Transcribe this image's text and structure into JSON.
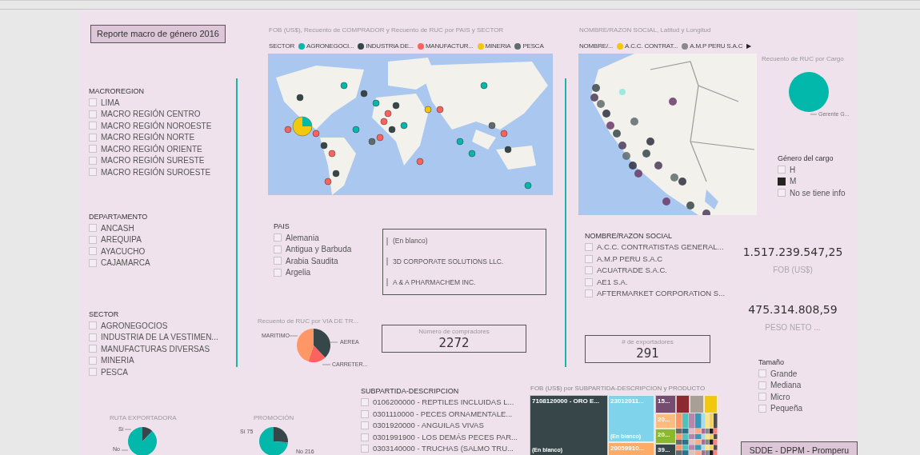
{
  "report_button": {
    "label": "Reporte macro de género 2016"
  },
  "macroregion": {
    "title": "MACROREGION",
    "items": [
      {
        "label": "LIMA",
        "checked": false
      },
      {
        "label": "MACRO REGIÓN CENTRO",
        "checked": false
      },
      {
        "label": "MACRO REGIÓN NOROESTE",
        "checked": false
      },
      {
        "label": "MACRO REGIÓN NORTE",
        "checked": false
      },
      {
        "label": "MACRO REGIÓN ORIENTE",
        "checked": false
      },
      {
        "label": "MACRO REGIÓN SURESTE",
        "checked": false
      },
      {
        "label": "MACRO REGIÓN SUROESTE",
        "checked": false
      }
    ]
  },
  "departamento": {
    "title": "DEPARTAMENTO",
    "items": [
      {
        "label": "ANCASH",
        "checked": false
      },
      {
        "label": "AREQUIPA",
        "checked": false
      },
      {
        "label": "AYACUCHO",
        "checked": false
      },
      {
        "label": "CAJAMARCA",
        "checked": false
      }
    ]
  },
  "sector": {
    "title": "SECTOR",
    "items": [
      {
        "label": "AGRONEGOCIOS",
        "checked": false
      },
      {
        "label": "INDUSTRIA DE LA VESTIMEN...",
        "checked": false
      },
      {
        "label": "MANUFACTURAS DIVERSAS",
        "checked": false
      },
      {
        "label": "MINERIA",
        "checked": false
      },
      {
        "label": "PESCA",
        "checked": false
      }
    ]
  },
  "world_map": {
    "title": "FOB (US$), Recuento de COMPRADOR y Recuento de RUC por PAIS y SECTOR",
    "legend_title": "SECTOR",
    "legend": [
      {
        "label": "AGRONEGOCI...",
        "color": "#01b8aa"
      },
      {
        "label": "INDUSTRIA DE...",
        "color": "#374649"
      },
      {
        "label": "MANUFACTUR...",
        "color": "#fd625e"
      },
      {
        "label": "MINERIA",
        "color": "#f2c80f"
      },
      {
        "label": "PESCA",
        "color": "#5f6b6d"
      }
    ]
  },
  "peru_map": {
    "title": "NOMBRE/RAZON SOCIAL, Latitud y Longitud",
    "legend_title": "NOMBRE/...",
    "legend": [
      {
        "label": "A.C.C. CONTRAT...",
        "color": "#f2c80f"
      },
      {
        "label": "A.M.P PERU S.A.C",
        "color": "#8a8a8a"
      }
    ],
    "more_arrow": "▶"
  },
  "cargo_chart": {
    "title": "Recuento de RUC por Cargo",
    "label": "Gerente G..."
  },
  "genero": {
    "title": "Género del cargo",
    "items": [
      {
        "label": "H",
        "checked": false
      },
      {
        "label": "M",
        "checked": true
      },
      {
        "label": "No se tiene info",
        "checked": false
      }
    ]
  },
  "pais": {
    "title": "PAIS",
    "items": [
      {
        "label": "Alemania",
        "checked": false
      },
      {
        "label": "Antigua y Barbuda",
        "checked": false
      },
      {
        "label": "Arabia Saudita",
        "checked": false
      },
      {
        "label": "Argelia",
        "checked": false
      }
    ]
  },
  "buyers_table": {
    "rows": [
      "(En blanco)",
      "3D CORPORATE SOLUTIONS LLC.",
      "A & A PHARMACHEM INC."
    ]
  },
  "via_chart": {
    "title": "Recuento de RUC por VIA DE TR...",
    "labels": [
      "MARITIMO",
      "AEREA",
      "CARRETER..."
    ]
  },
  "compradores_card": {
    "label": "Número de compradores",
    "value": "2272"
  },
  "nombre": {
    "title": "NOMBRE/RAZON SOCIAL",
    "items": [
      {
        "label": "A.C.C. CONTRATISTAS GENERAL...",
        "checked": false
      },
      {
        "label": "A.M.P PERU S.A.C",
        "checked": false
      },
      {
        "label": "ACUATRADE S.A.C.",
        "checked": false
      },
      {
        "label": "AE1 S.A.",
        "checked": false
      },
      {
        "label": "AFTERMARKET CORPORATION S...",
        "checked": false
      }
    ]
  },
  "fob_card": {
    "value": "1.517.239.547,25",
    "label": "FOB (US$)"
  },
  "peso_card": {
    "value": "475.314.808,59",
    "label": "PESO NETO ..."
  },
  "exportadores_card": {
    "label": "# de exportadores",
    "value": "291"
  },
  "tamano": {
    "title": "Tamaño",
    "items": [
      {
        "label": "Grande",
        "checked": false
      },
      {
        "label": "Mediana",
        "checked": false
      },
      {
        "label": "Micro",
        "checked": false
      },
      {
        "label": "Pequeña",
        "checked": false
      }
    ]
  },
  "subpartida": {
    "title": "SUBPARTIDA-DESCRIPCION",
    "items": [
      {
        "label": "0106200000 - REPTILES INCLUIDAS L...",
        "checked": false
      },
      {
        "label": "0301110000 - PECES ORNAMENTALE...",
        "checked": false
      },
      {
        "label": "0301920000 - ANGUILAS VIVAS",
        "checked": false
      },
      {
        "label": "0301991900 - LOS DEMÁS PECES PAR...",
        "checked": false
      },
      {
        "label": "0303140000 - TRUCHAS (SALMO TRU...",
        "checked": false
      }
    ]
  },
  "treemap": {
    "title": "FOB (US$) por SUBPARTIDA-DESCRIPCION y PRODUCTO",
    "tiles": [
      {
        "label": "7108120000 - ORO E...",
        "sublabel": "(En blanco)",
        "color": "#374649"
      },
      {
        "label": "23012011...",
        "sublabel": "(En blanco)",
        "color": "#7fd3ea"
      },
      {
        "label": "20059910...",
        "color": "#fdab67"
      },
      {
        "label": "15...",
        "color": "#744d71"
      },
      {
        "label": "20...",
        "color": "#fdbb7e"
      },
      {
        "label": "20...",
        "color": "#8ab833"
      },
      {
        "label": "39...",
        "color": "#374649"
      },
      {
        "color": "#8b2a30"
      },
      {
        "color": "#a8a096"
      },
      {
        "color": "#f2c80f"
      }
    ]
  },
  "ruta_chart": {
    "title": "RUTA EXPORTADORA",
    "labels": [
      "Sí",
      "No"
    ]
  },
  "promocion_chart": {
    "title": "PROMOCIÓN",
    "labels": [
      "Sí 75",
      "No 216"
    ]
  },
  "footer_button": {
    "label": "SDDE - DPPM - Promperu"
  }
}
